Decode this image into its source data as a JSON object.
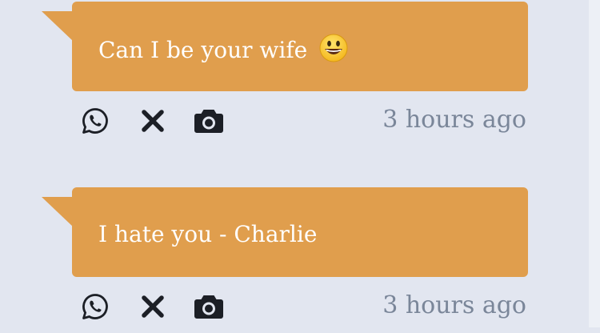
{
  "messages": [
    {
      "text": "Can I be your wife",
      "emoji": "grinning-face-emoji",
      "time": "3 hours ago",
      "actions": [
        "whatsapp-icon",
        "close-icon",
        "camera-icon"
      ]
    },
    {
      "text": "I hate you - Charlie",
      "time": "3 hours ago",
      "actions": [
        "whatsapp-icon",
        "close-icon",
        "camera-icon"
      ]
    }
  ],
  "colors": {
    "background": "#e2e6f0",
    "bubble": "#e09e4d",
    "bubble_text": "#ffffff",
    "timestamp": "#7a8699",
    "icon": "#1c1f26"
  }
}
